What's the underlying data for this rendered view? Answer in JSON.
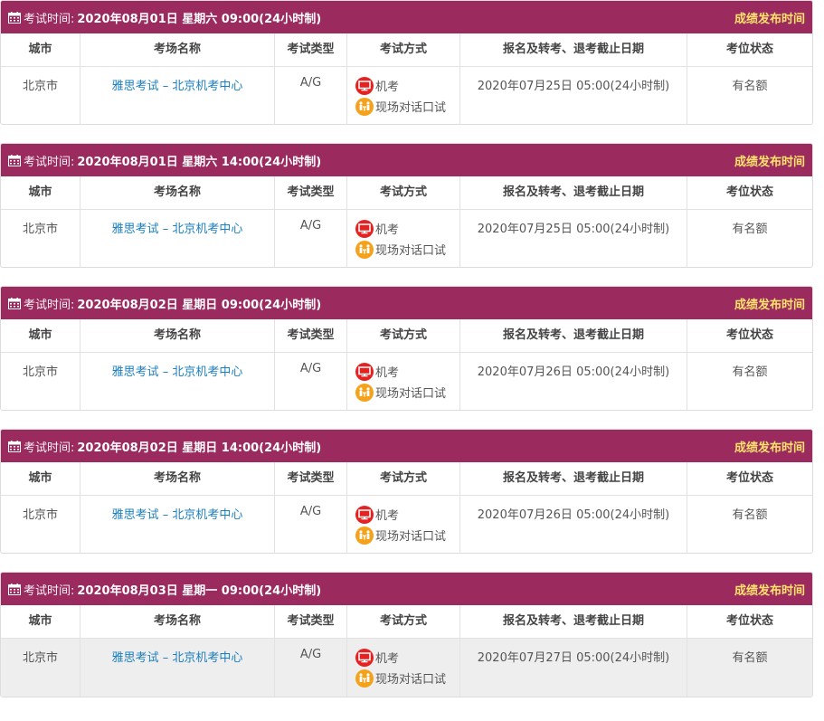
{
  "header_label": "考试时间:",
  "results_label": "成绩发布时间",
  "columns": [
    "城市",
    "考场名称",
    "考试类型",
    "考试方式",
    "报名及转考、退考截止日期",
    "考位状态"
  ],
  "modes": [
    "机考",
    "现场对话口试"
  ],
  "colors": {
    "header_bg": "#9b2a5f",
    "results_text": "#ffe36a",
    "link": "#1b7fbd",
    "computer_icon": "#e52222",
    "speaking_icon": "#f4a21b"
  },
  "sessions": [
    {
      "time": "2020年08月01日 星期六 09:00(24小时制)",
      "city": "北京市",
      "venue": "雅思考试 – 北京机考中心",
      "type": "A/G",
      "deadline": "2020年07月25日 05:00(24小时制)",
      "status": "有名额"
    },
    {
      "time": "2020年08月01日 星期六 14:00(24小时制)",
      "city": "北京市",
      "venue": "雅思考试 – 北京机考中心",
      "type": "A/G",
      "deadline": "2020年07月25日 05:00(24小时制)",
      "status": "有名额"
    },
    {
      "time": "2020年08月02日 星期日 09:00(24小时制)",
      "city": "北京市",
      "venue": "雅思考试 – 北京机考中心",
      "type": "A/G",
      "deadline": "2020年07月26日 05:00(24小时制)",
      "status": "有名额"
    },
    {
      "time": "2020年08月02日 星期日 14:00(24小时制)",
      "city": "北京市",
      "venue": "雅思考试 – 北京机考中心",
      "type": "A/G",
      "deadline": "2020年07月26日 05:00(24小时制)",
      "status": "有名额"
    },
    {
      "time": "2020年08月03日 星期一 09:00(24小时制)",
      "city": "北京市",
      "venue": "雅思考试 – 北京机考中心",
      "type": "A/G",
      "deadline": "2020年07月27日 05:00(24小时制)",
      "status": "有名额"
    }
  ]
}
